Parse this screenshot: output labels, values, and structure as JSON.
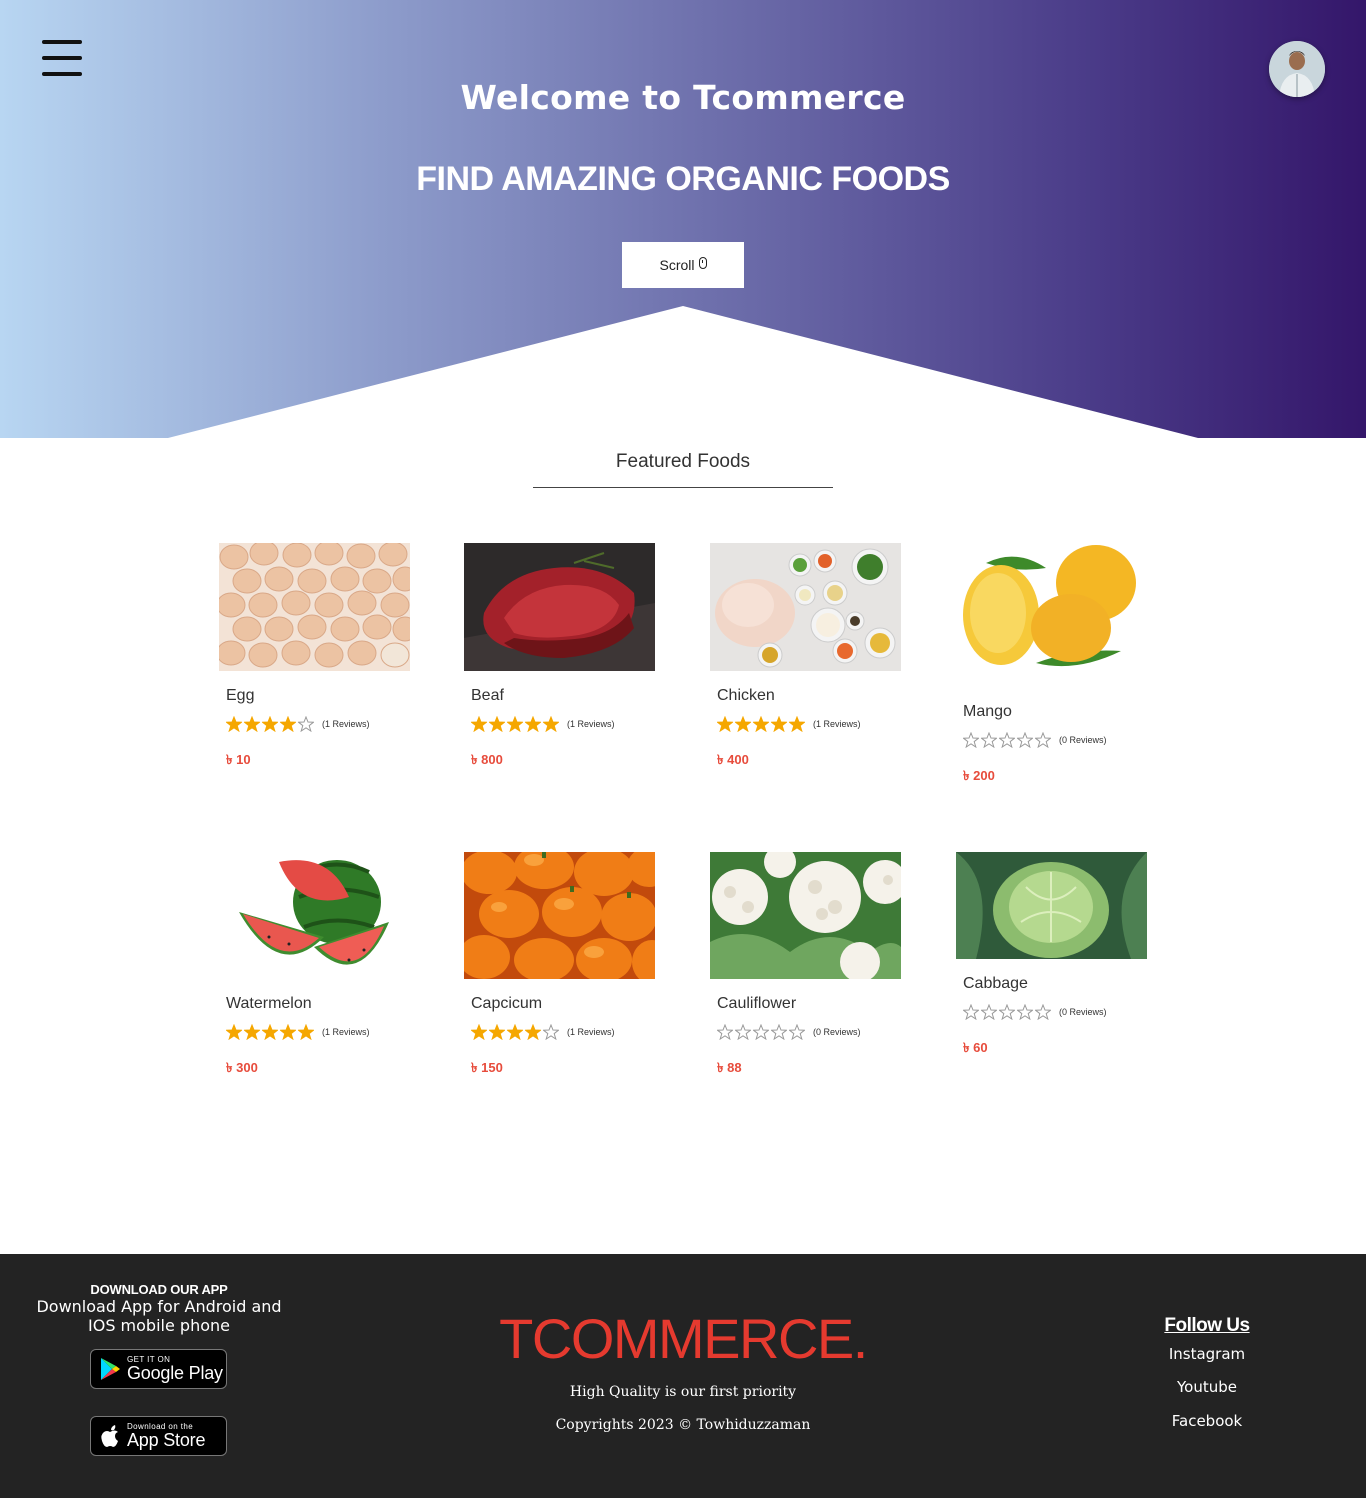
{
  "hero": {
    "welcome": "Welcome to Tcommerce",
    "tagline": "FIND AMAZING ORGANIC FOODS",
    "scroll_label": "Scroll"
  },
  "featured": {
    "title": "Featured Foods",
    "currency": "৳",
    "star_color": "#f5a700",
    "price_color": "#e74c3c",
    "items": [
      {
        "name": "Egg",
        "rating": 4,
        "reviews": "(1 Reviews)",
        "price": "10",
        "image_icon": "eggs-image"
      },
      {
        "name": "Beaf",
        "rating": 5,
        "reviews": "(1 Reviews)",
        "price": "800",
        "image_icon": "beef-image"
      },
      {
        "name": "Chicken",
        "rating": 5,
        "reviews": "(1 Reviews)",
        "price": "400",
        "image_icon": "chicken-image"
      },
      {
        "name": "Mango",
        "rating": 0,
        "reviews": "(0 Reviews)",
        "price": "200",
        "image_icon": "mango-image"
      },
      {
        "name": "Watermelon",
        "rating": 5,
        "reviews": "(1 Reviews)",
        "price": "300",
        "image_icon": "watermelon-image"
      },
      {
        "name": "Capcicum",
        "rating": 4,
        "reviews": "(1 Reviews)",
        "price": "150",
        "image_icon": "capsicum-image"
      },
      {
        "name": "Cauliflower",
        "rating": 0,
        "reviews": "(0 Reviews)",
        "price": "88",
        "image_icon": "cauliflower-image"
      },
      {
        "name": "Cabbage",
        "rating": 0,
        "reviews": "(0 Reviews)",
        "price": "60",
        "image_icon": "cabbage-image"
      }
    ]
  },
  "footer": {
    "download_title": "DOWNLOAD OUR APP",
    "download_text": "Download App for Android and IOS mobile phone",
    "google_play": {
      "small": "GET IT ON",
      "big": "Google Play"
    },
    "app_store": {
      "small": "Download on the",
      "big": "App Store"
    },
    "brand": "TCOMMERCE.",
    "brand_color": "#e53a2f",
    "tagline": "High Quality is our first priority",
    "copyright": "Copyrights 2023 © Towhiduzzaman",
    "follow_title": "Follow Us",
    "links": [
      "Instagram",
      "Youtube",
      "Facebook"
    ]
  }
}
